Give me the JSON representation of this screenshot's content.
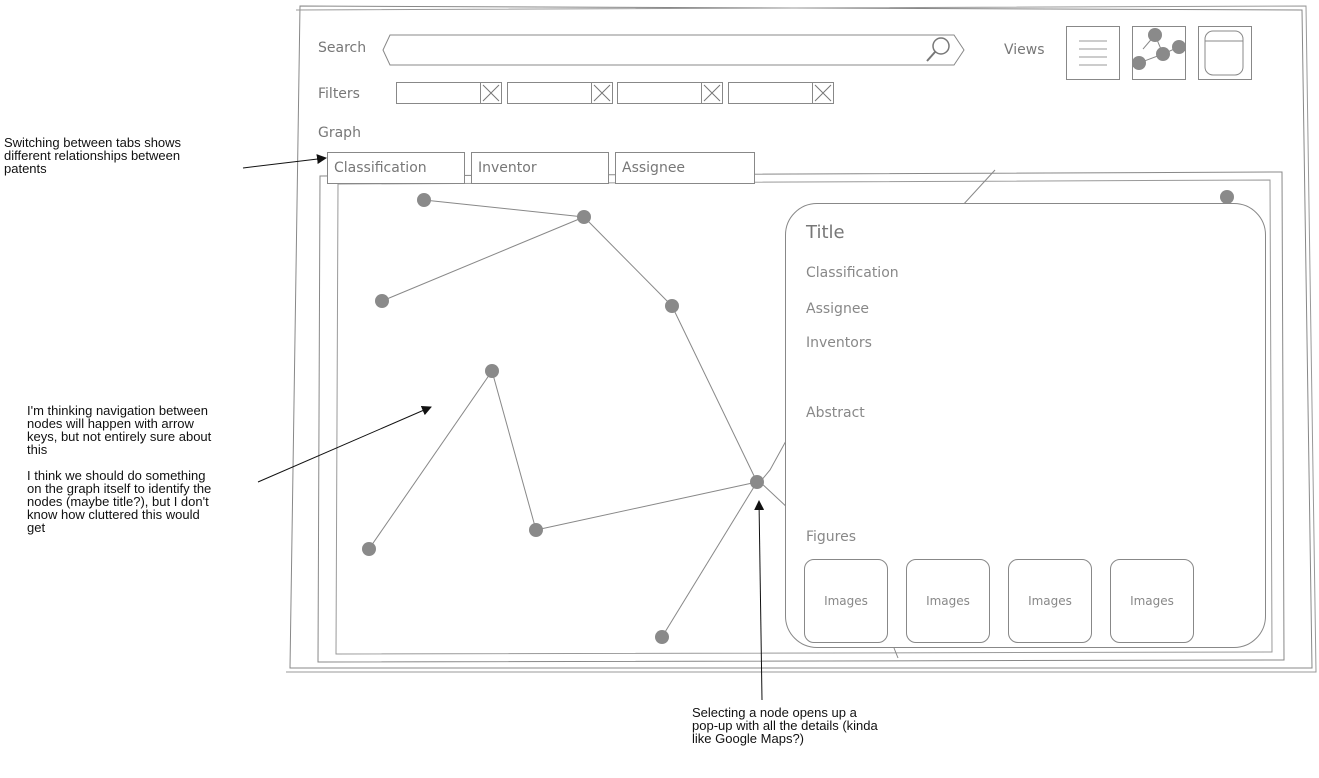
{
  "toolbar": {
    "search_label": "Search",
    "views_label": "Views",
    "filters_label": "Filters",
    "graph_label": "Graph"
  },
  "tabs": [
    {
      "label": "Classification"
    },
    {
      "label": "Inventor"
    },
    {
      "label": "Assignee"
    }
  ],
  "popup": {
    "title": "Title",
    "classification": "Classification",
    "assignee": "Assignee",
    "inventors": "Inventors",
    "abstract": "Abstract",
    "figures": "Figures",
    "images": [
      "Images",
      "Images",
      "Images",
      "Images"
    ]
  },
  "annotations": {
    "tabs_note": "Switching between tabs shows\ndifferent relationships between\npatents",
    "nav_note": "I'm thinking navigation between\nnodes will happen with arrow\nkeys, but not entirely sure about\nthis\n\nI think we should do something\non the graph itself to identify the\nnodes (maybe title?), but I don't\nknow how cluttered this would\nget",
    "popup_note": "Selecting a node opens up a\npop-up with all the details (kinda\nlike Google Maps?)"
  },
  "icons": {
    "search": "magnifier-icon",
    "list_view": "list-view-icon",
    "graph_view": "graph-view-icon",
    "card_view": "card-view-icon"
  }
}
